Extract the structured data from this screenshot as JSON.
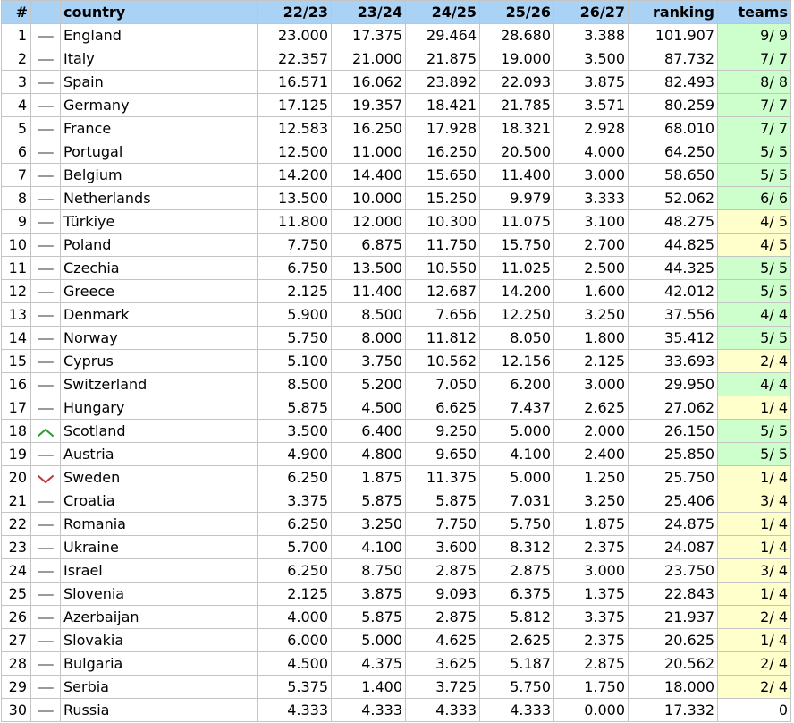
{
  "headers": {
    "rank": "#",
    "country": "country",
    "y2223": "22/23",
    "y2324": "23/24",
    "y2425": "24/25",
    "y2526": "25/26",
    "y2627": "26/27",
    "ranking": "ranking",
    "teams": "teams"
  },
  "colors": {
    "header_bg": "#a9d2f5",
    "teams_green": "#ccffcc",
    "teams_yellow": "#ffffcc",
    "trend_same": "#9a9a9a",
    "trend_up": "#2e9a2e",
    "trend_down": "#c83232"
  },
  "rows": [
    {
      "rank": "1",
      "trend": "same",
      "country": "England",
      "y2223": "23.000",
      "y2324": "17.375",
      "y2425": "29.464",
      "y2526": "28.680",
      "y2627": "3.388",
      "ranking": "101.907",
      "teams": "9/ 9",
      "teams_status": "green"
    },
    {
      "rank": "2",
      "trend": "same",
      "country": "Italy",
      "y2223": "22.357",
      "y2324": "21.000",
      "y2425": "21.875",
      "y2526": "19.000",
      "y2627": "3.500",
      "ranking": "87.732",
      "teams": "7/ 7",
      "teams_status": "green"
    },
    {
      "rank": "3",
      "trend": "same",
      "country": "Spain",
      "y2223": "16.571",
      "y2324": "16.062",
      "y2425": "23.892",
      "y2526": "22.093",
      "y2627": "3.875",
      "ranking": "82.493",
      "teams": "8/ 8",
      "teams_status": "green"
    },
    {
      "rank": "4",
      "trend": "same",
      "country": "Germany",
      "y2223": "17.125",
      "y2324": "19.357",
      "y2425": "18.421",
      "y2526": "21.785",
      "y2627": "3.571",
      "ranking": "80.259",
      "teams": "7/ 7",
      "teams_status": "green"
    },
    {
      "rank": "5",
      "trend": "same",
      "country": "France",
      "y2223": "12.583",
      "y2324": "16.250",
      "y2425": "17.928",
      "y2526": "18.321",
      "y2627": "2.928",
      "ranking": "68.010",
      "teams": "7/ 7",
      "teams_status": "green"
    },
    {
      "rank": "6",
      "trend": "same",
      "country": "Portugal",
      "y2223": "12.500",
      "y2324": "11.000",
      "y2425": "16.250",
      "y2526": "20.500",
      "y2627": "4.000",
      "ranking": "64.250",
      "teams": "5/ 5",
      "teams_status": "green"
    },
    {
      "rank": "7",
      "trend": "same",
      "country": "Belgium",
      "y2223": "14.200",
      "y2324": "14.400",
      "y2425": "15.650",
      "y2526": "11.400",
      "y2627": "3.000",
      "ranking": "58.650",
      "teams": "5/ 5",
      "teams_status": "green"
    },
    {
      "rank": "8",
      "trend": "same",
      "country": "Netherlands",
      "y2223": "13.500",
      "y2324": "10.000",
      "y2425": "15.250",
      "y2526": "9.979",
      "y2627": "3.333",
      "ranking": "52.062",
      "teams": "6/ 6",
      "teams_status": "green"
    },
    {
      "rank": "9",
      "trend": "same",
      "country": "Türkiye",
      "y2223": "11.800",
      "y2324": "12.000",
      "y2425": "10.300",
      "y2526": "11.075",
      "y2627": "3.100",
      "ranking": "48.275",
      "teams": "4/ 5",
      "teams_status": "yellow"
    },
    {
      "rank": "10",
      "trend": "same",
      "country": "Poland",
      "y2223": "7.750",
      "y2324": "6.875",
      "y2425": "11.750",
      "y2526": "15.750",
      "y2627": "2.700",
      "ranking": "44.825",
      "teams": "4/ 5",
      "teams_status": "yellow"
    },
    {
      "rank": "11",
      "trend": "same",
      "country": "Czechia",
      "y2223": "6.750",
      "y2324": "13.500",
      "y2425": "10.550",
      "y2526": "11.025",
      "y2627": "2.500",
      "ranking": "44.325",
      "teams": "5/ 5",
      "teams_status": "green"
    },
    {
      "rank": "12",
      "trend": "same",
      "country": "Greece",
      "y2223": "2.125",
      "y2324": "11.400",
      "y2425": "12.687",
      "y2526": "14.200",
      "y2627": "1.600",
      "ranking": "42.012",
      "teams": "5/ 5",
      "teams_status": "green"
    },
    {
      "rank": "13",
      "trend": "same",
      "country": "Denmark",
      "y2223": "5.900",
      "y2324": "8.500",
      "y2425": "7.656",
      "y2526": "12.250",
      "y2627": "3.250",
      "ranking": "37.556",
      "teams": "4/ 4",
      "teams_status": "green"
    },
    {
      "rank": "14",
      "trend": "same",
      "country": "Norway",
      "y2223": "5.750",
      "y2324": "8.000",
      "y2425": "11.812",
      "y2526": "8.050",
      "y2627": "1.800",
      "ranking": "35.412",
      "teams": "5/ 5",
      "teams_status": "green"
    },
    {
      "rank": "15",
      "trend": "same",
      "country": "Cyprus",
      "y2223": "5.100",
      "y2324": "3.750",
      "y2425": "10.562",
      "y2526": "12.156",
      "y2627": "2.125",
      "ranking": "33.693",
      "teams": "2/ 4",
      "teams_status": "yellow"
    },
    {
      "rank": "16",
      "trend": "same",
      "country": "Switzerland",
      "y2223": "8.500",
      "y2324": "5.200",
      "y2425": "7.050",
      "y2526": "6.200",
      "y2627": "3.000",
      "ranking": "29.950",
      "teams": "4/ 4",
      "teams_status": "green"
    },
    {
      "rank": "17",
      "trend": "same",
      "country": "Hungary",
      "y2223": "5.875",
      "y2324": "4.500",
      "y2425": "6.625",
      "y2526": "7.437",
      "y2627": "2.625",
      "ranking": "27.062",
      "teams": "1/ 4",
      "teams_status": "yellow"
    },
    {
      "rank": "18",
      "trend": "up",
      "country": "Scotland",
      "y2223": "3.500",
      "y2324": "6.400",
      "y2425": "9.250",
      "y2526": "5.000",
      "y2627": "2.000",
      "ranking": "26.150",
      "teams": "5/ 5",
      "teams_status": "green"
    },
    {
      "rank": "19",
      "trend": "same",
      "country": "Austria",
      "y2223": "4.900",
      "y2324": "4.800",
      "y2425": "9.650",
      "y2526": "4.100",
      "y2627": "2.400",
      "ranking": "25.850",
      "teams": "5/ 5",
      "teams_status": "green"
    },
    {
      "rank": "20",
      "trend": "down",
      "country": "Sweden",
      "y2223": "6.250",
      "y2324": "1.875",
      "y2425": "11.375",
      "y2526": "5.000",
      "y2627": "1.250",
      "ranking": "25.750",
      "teams": "1/ 4",
      "teams_status": "yellow"
    },
    {
      "rank": "21",
      "trend": "same",
      "country": "Croatia",
      "y2223": "3.375",
      "y2324": "5.875",
      "y2425": "5.875",
      "y2526": "7.031",
      "y2627": "3.250",
      "ranking": "25.406",
      "teams": "3/ 4",
      "teams_status": "yellow"
    },
    {
      "rank": "22",
      "trend": "same",
      "country": "Romania",
      "y2223": "6.250",
      "y2324": "3.250",
      "y2425": "7.750",
      "y2526": "5.750",
      "y2627": "1.875",
      "ranking": "24.875",
      "teams": "1/ 4",
      "teams_status": "yellow"
    },
    {
      "rank": "23",
      "trend": "same",
      "country": "Ukraine",
      "y2223": "5.700",
      "y2324": "4.100",
      "y2425": "3.600",
      "y2526": "8.312",
      "y2627": "2.375",
      "ranking": "24.087",
      "teams": "1/ 4",
      "teams_status": "yellow"
    },
    {
      "rank": "24",
      "trend": "same",
      "country": "Israel",
      "y2223": "6.250",
      "y2324": "8.750",
      "y2425": "2.875",
      "y2526": "2.875",
      "y2627": "3.000",
      "ranking": "23.750",
      "teams": "3/ 4",
      "teams_status": "yellow"
    },
    {
      "rank": "25",
      "trend": "same",
      "country": "Slovenia",
      "y2223": "2.125",
      "y2324": "3.875",
      "y2425": "9.093",
      "y2526": "6.375",
      "y2627": "1.375",
      "ranking": "22.843",
      "teams": "1/ 4",
      "teams_status": "yellow"
    },
    {
      "rank": "26",
      "trend": "same",
      "country": "Azerbaijan",
      "y2223": "4.000",
      "y2324": "5.875",
      "y2425": "2.875",
      "y2526": "5.812",
      "y2627": "3.375",
      "ranking": "21.937",
      "teams": "2/ 4",
      "teams_status": "yellow"
    },
    {
      "rank": "27",
      "trend": "same",
      "country": "Slovakia",
      "y2223": "6.000",
      "y2324": "5.000",
      "y2425": "4.625",
      "y2526": "2.625",
      "y2627": "2.375",
      "ranking": "20.625",
      "teams": "1/ 4",
      "teams_status": "yellow"
    },
    {
      "rank": "28",
      "trend": "same",
      "country": "Bulgaria",
      "y2223": "4.500",
      "y2324": "4.375",
      "y2425": "3.625",
      "y2526": "5.187",
      "y2627": "2.875",
      "ranking": "20.562",
      "teams": "2/ 4",
      "teams_status": "yellow"
    },
    {
      "rank": "29",
      "trend": "same",
      "country": "Serbia",
      "y2223": "5.375",
      "y2324": "1.400",
      "y2425": "3.725",
      "y2526": "5.750",
      "y2627": "1.750",
      "ranking": "18.000",
      "teams": "2/ 4",
      "teams_status": "yellow"
    },
    {
      "rank": "30",
      "trend": "same",
      "country": "Russia",
      "y2223": "4.333",
      "y2324": "4.333",
      "y2425": "4.333",
      "y2526": "4.333",
      "y2627": "0.000",
      "ranking": "17.332",
      "teams": "0",
      "teams_status": "none"
    }
  ]
}
